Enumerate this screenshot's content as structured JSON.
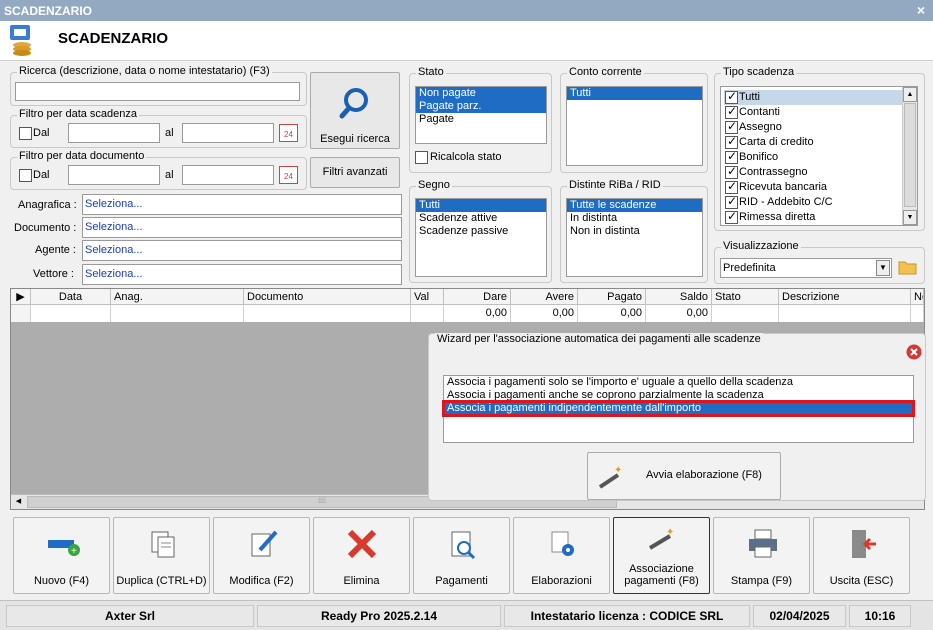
{
  "window": {
    "title": "SCADENZARIO",
    "close_glyph": "×",
    "header_title": "SCADENZARIO",
    "header_icon": "coins-icon"
  },
  "search": {
    "group_label": "Ricerca (descrizione, data o nome intestatario) (F3)",
    "value": "",
    "execute_label": "Esegui ricerca"
  },
  "filter_due": {
    "group_label": "Filtro per data scadenza",
    "from_label": "Dal",
    "to_label": "al",
    "from_value": "",
    "to_value": "",
    "calendar_day": "24"
  },
  "filter_doc": {
    "group_label": "Filtro per data documento",
    "from_label": "Dal",
    "to_label": "al",
    "from_value": "",
    "to_value": "",
    "calendar_day": "24"
  },
  "advanced_filters_label": "Filtri avanzati",
  "fields": [
    {
      "label": "Anagrafica :",
      "value": "Seleziona..."
    },
    {
      "label": "Documento :",
      "value": "Seleziona..."
    },
    {
      "label": "Agente :",
      "value": "Seleziona..."
    },
    {
      "label": "Vettore :",
      "value": "Seleziona..."
    }
  ],
  "stato": {
    "group_label": "Stato",
    "items": [
      "Non pagate",
      "Pagate parz.",
      "Pagate"
    ],
    "selected": [
      0,
      1
    ],
    "recalc_label": "Ricalcola stato"
  },
  "conto": {
    "group_label": "Conto corrente",
    "items": [
      "Tutti"
    ],
    "selected": [
      0
    ]
  },
  "segno": {
    "group_label": "Segno",
    "items": [
      "Tutti",
      "Scadenze attive",
      "Scadenze passive"
    ],
    "selected": [
      0
    ]
  },
  "distinte": {
    "group_label": "Distinte RiBa / RID",
    "items": [
      "Tutte le scadenze",
      "In distinta",
      "Non in distinta"
    ],
    "selected": [
      0
    ]
  },
  "tipo": {
    "group_label": "Tipo scadenza",
    "items": [
      "Tutti",
      "Contanti",
      "Assegno",
      "Carta di credito",
      "Bonifico",
      "Contrassegno",
      "Ricevuta bancaria",
      "RID - Addebito C/C",
      "Rimessa diretta"
    ]
  },
  "visualizzazione": {
    "group_label": "Visualizzazione",
    "value": "Predefinita"
  },
  "grid": {
    "columns": [
      "Data",
      "Anag.",
      "Documento",
      "Val",
      "Dare",
      "Avere",
      "Pagato",
      "Saldo",
      "Stato",
      "Descrizione",
      "No"
    ],
    "totals": {
      "dare": "0,00",
      "avere": "0,00",
      "pagato": "0,00",
      "saldo": "0,00"
    },
    "scroll_grip": "⁞⁞⁞⁞"
  },
  "wizard": {
    "title": "Wizard per l'associazione automatica dei pagamenti alle scadenze",
    "options": [
      "Associa i pagamenti solo se l'importo e' uguale a quello della scadenza",
      "Associa i pagamenti anche se coprono parzialmente la scadenza",
      "Associa i pagamenti indipendentemente dall'importo"
    ],
    "selected": 2,
    "run_label": "Avvia elaborazione (F8)"
  },
  "toolbar": [
    {
      "label": "Nuovo (F4)",
      "icon": "new-card-icon"
    },
    {
      "label": "Duplica (CTRL+D)",
      "icon": "duplicate-icon"
    },
    {
      "label": "Modifica (F2)",
      "icon": "edit-icon"
    },
    {
      "label": "Elimina",
      "icon": "delete-x-icon"
    },
    {
      "label": "Pagamenti",
      "icon": "search-document-icon"
    },
    {
      "label": "Elaborazioni",
      "icon": "gears-icon"
    },
    {
      "label": "Associazione pagamenti (F8)",
      "icon": "magic-wand-icon"
    },
    {
      "label": "Stampa (F9)",
      "icon": "printer-icon"
    },
    {
      "label": "Uscita (ESC)",
      "icon": "exit-door-icon"
    }
  ],
  "status": {
    "company": "Axter Srl",
    "version": "Ready Pro 2025.2.14",
    "license": "Intestatario licenza : CODICE SRL",
    "date": "02/04/2025",
    "time": "10:16"
  },
  "colors": {
    "selection": "#1f6cc4",
    "titlebar": "#93a9c2",
    "delete_red": "#d93a2b",
    "highlight_border": "#e0141e"
  }
}
